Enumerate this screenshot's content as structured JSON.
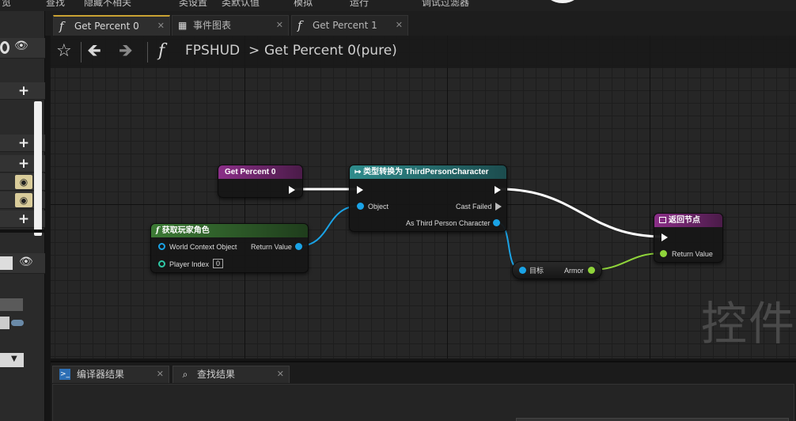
{
  "top_menu": [
    "览",
    "查找",
    "隐藏不相关",
    "类设置",
    "类默认值",
    "模拟",
    "运行",
    "调试过滤器"
  ],
  "tabs": [
    {
      "label": "Get Percent 0",
      "icon": "function-icon",
      "active": true
    },
    {
      "label": "事件图表",
      "icon": "event-graph-icon",
      "active": false
    },
    {
      "label": "Get Percent 1",
      "icon": "function-icon",
      "active": false
    }
  ],
  "breadcrumb": {
    "owner": "FPSHUD",
    "separator": ">",
    "function": "Get Percent 0(pure)"
  },
  "nodes": {
    "entry": {
      "title": "Get Percent 0"
    },
    "cast": {
      "title": "类型转换为 ThirdPersonCharacter",
      "object_pin": "Object",
      "cast_failed_pin": "Cast Failed",
      "as_pin": "As Third Person Character"
    },
    "get_player": {
      "title": "获取玩家角色",
      "world_context_pin": "World Context Object",
      "return_pin": "Return Value",
      "player_index_pin": "Player Index",
      "player_index_value": "0"
    },
    "armor": {
      "target_pin": "目标",
      "value_pin": "Armor"
    },
    "return": {
      "title": "返回节点",
      "return_pin": "Return Value"
    }
  },
  "watermark": "控件",
  "bottom_tabs": [
    {
      "label": "编译器结果",
      "icon": "compiler-results-icon"
    },
    {
      "label": "查找结果",
      "icon": "find-results-icon"
    }
  ],
  "colors": {
    "function_header": "#7a2b78",
    "cast_header": "#2e7d7e",
    "object_pin": "#1aa3e6",
    "float_pin": "#8fd43a",
    "accent_tab": "#c9a233"
  }
}
